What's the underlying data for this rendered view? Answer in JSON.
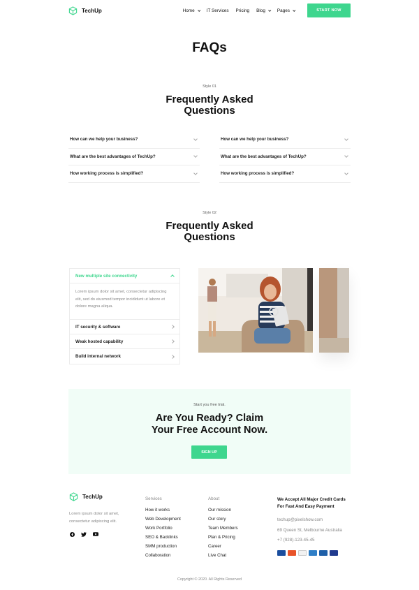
{
  "brand": {
    "name": "TechUp",
    "accent": "#3ed68e"
  },
  "nav": {
    "items": [
      {
        "label": "Home",
        "dropdown": true
      },
      {
        "label": "IT Services",
        "dropdown": false
      },
      {
        "label": "Pricing",
        "dropdown": false
      },
      {
        "label": "Blog",
        "dropdown": true
      },
      {
        "label": "Pages",
        "dropdown": true
      }
    ],
    "cta": "START NOW"
  },
  "page_title": "FAQs",
  "style1": {
    "label": "Style 01",
    "heading_line1": "Frequently Asked",
    "heading_line2": "Questions",
    "left": [
      "How can we help your business?",
      "What are the best advantages of TechUp?",
      "How working process is simplified?"
    ],
    "right": [
      "How can we help your business?",
      "What are the best advantages of TechUp?",
      "How working process is simplified?"
    ]
  },
  "style2": {
    "label": "Style 02",
    "heading_line1": "Frequently Asked",
    "heading_line2": "Questions",
    "open_item": "New multiple site connectivity",
    "open_body": "Lorem ipsum dolor sit amet, consectetur adipiscing elit, sed do eiusmod tempor incididunt ut labore et dolore magna aliqua.",
    "items": [
      "IT security & software",
      "Weak hosted capability",
      "Build internal network"
    ]
  },
  "cta": {
    "subtitle": "Start you free trial.",
    "title_line1": "Are You Ready? Claim",
    "title_line2": "Your Free Account Now.",
    "button": "SIGN UP"
  },
  "footer": {
    "brand": "TechUp",
    "description": "Lorem ipsum dolor sit amet, consectetur adipiscing elit.",
    "services_title": "Services",
    "services": [
      "How it works",
      "Web Development",
      "Work Portfolio",
      "SEO & Backlinks",
      "SMM production",
      "Collaboration"
    ],
    "about_title": "About",
    "about": [
      "Our mission",
      "Our story",
      "Team Members",
      "Plan & Pricing",
      "Career",
      "Live Chat"
    ],
    "cards_title_line1": "We Accept All Major Credit Cards",
    "cards_title_line2": "For Fast And Easy Payment",
    "email": "techup@pixelshow.com",
    "address": "69 Queen St, Melbourne Australia",
    "phone": "+7 (928)-123-45-45",
    "copyright": "Copyright © 2020. All Rights Reserved"
  }
}
